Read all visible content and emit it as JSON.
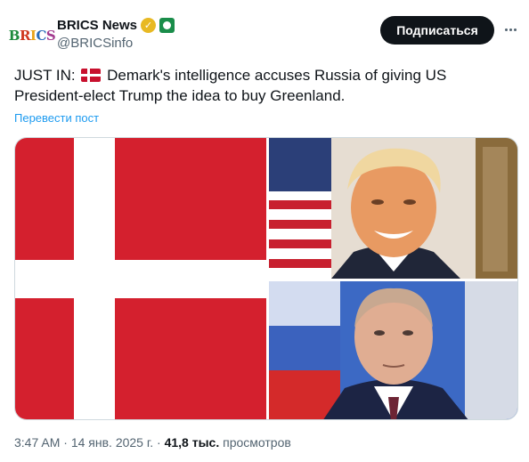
{
  "author": {
    "display_name": "BRICS News",
    "handle": "@BRICSinfo",
    "avatar_text": "BRICS"
  },
  "actions": {
    "subscribe_label": "Подписаться"
  },
  "tweet": {
    "prefix": "JUST IN:",
    "body": "Demark's intelligence accuses Russia of giving US President-elect Trump the idea to buy Greenland.",
    "translate_label": "Перевести пост"
  },
  "meta": {
    "time": "3:47 AM",
    "separator1": " · ",
    "date": "14 янв. 2025 г.",
    "separator2": " · ",
    "views_count": "41,8 тыс.",
    "views_label": "просмотров"
  },
  "colors": {
    "accent": "#1d9bf0",
    "button_bg": "#0f1419",
    "muted_text": "#536471",
    "denmark_red": "#d4202e"
  },
  "icons": {
    "verified": "gold-verified-badge-icon",
    "affiliate": "green-affiliate-badge-icon",
    "more": "more-dots-icon",
    "flag": "denmark-flag-icon"
  }
}
